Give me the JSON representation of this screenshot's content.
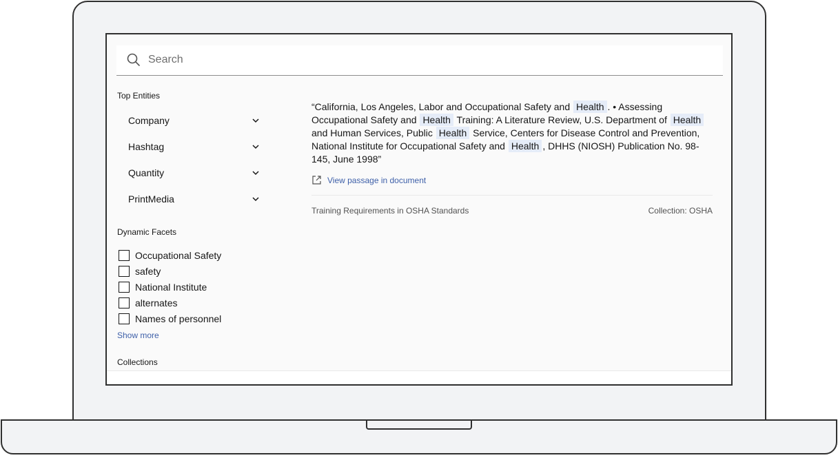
{
  "search": {
    "placeholder": "Search",
    "value": ""
  },
  "sidebar": {
    "top_entities_title": "Top Entities",
    "entities": [
      {
        "label": "Company"
      },
      {
        "label": "Hashtag"
      },
      {
        "label": "Quantity"
      },
      {
        "label": "PrintMedia"
      }
    ],
    "dynamic_facets_title": "Dynamic Facets",
    "facets": [
      {
        "label": "Occupational Safety",
        "checked": false
      },
      {
        "label": "safety",
        "checked": false
      },
      {
        "label": "National Institute",
        "checked": false
      },
      {
        "label": "alternates",
        "checked": false
      },
      {
        "label": "Names of personnel",
        "checked": false
      }
    ],
    "show_more_label": "Show more",
    "collections_title": "Collections"
  },
  "result": {
    "passage": {
      "t1": "“California, Los Angeles, Labor and Occupational Safety and",
      "h1": "Health",
      "t2": ". • Assessing Occupational Safety and",
      "h2": "Health",
      "t3": "Training: A Literature Review, U.S. Department of",
      "h3": "Health",
      "t4": "and Human Services, Public",
      "h4": "Health",
      "t5": "Service, Centers for Disease Control and Prevention, National Institute for Occupational Safety and",
      "h5": "Health",
      "t6": ", DHHS (NIOSH) Publication No. 98-145, June 1998”"
    },
    "view_link_label": "View passage in document",
    "document_title": "Training Requirements in OSHA Standards",
    "collection_label": "Collection: OSHA"
  },
  "colors": {
    "highlight": "#e5ecf8",
    "link": "#3d5fa8",
    "frame": "#2f2f2f",
    "frame_fill": "#f2f3f5"
  },
  "icons": {
    "search": "search-icon",
    "chevron": "chevron-down-icon",
    "launch": "launch-icon"
  }
}
